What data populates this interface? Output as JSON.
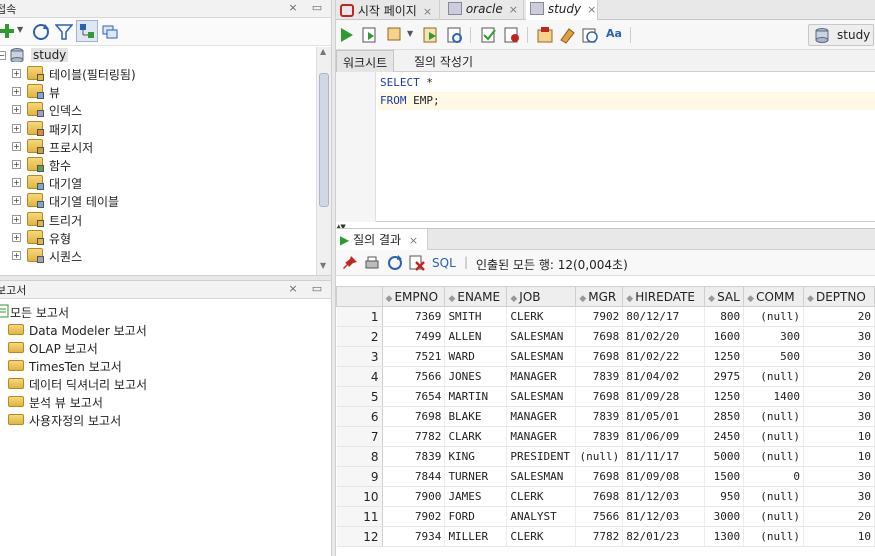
{
  "connections": {
    "title": "접속",
    "tree": {
      "root": "study",
      "items": [
        "테이블(필터링됨)",
        "뷰",
        "인덱스",
        "패키지",
        "프로시저",
        "함수",
        "대기열",
        "대기열 테이블",
        "트리거",
        "유형",
        "시퀀스"
      ]
    }
  },
  "reports": {
    "title": "보고서",
    "root": "모든 보고서",
    "items": [
      "Data Modeler 보고서",
      "OLAP 보고서",
      "TimesTen 보고서",
      "데이터 딕셔너리 보고서",
      "분석 뷰 보고서",
      "사용자정의 보고서"
    ]
  },
  "editor_tabs": [
    {
      "label": "시작 페이지"
    },
    {
      "label": "oracle"
    },
    {
      "label": "study"
    }
  ],
  "toolbar": {
    "connection_label": "study"
  },
  "subtabs": [
    "워크시트",
    "질의 작성기"
  ],
  "sql": {
    "line1_kw": "SELECT",
    "line1_rest": " *",
    "line2_kw": "FROM",
    "line2_rest": " EMP;"
  },
  "results": {
    "tab_label": "질의 결과",
    "sql_label": "SQL",
    "status": "인출된 모든 행: 12(0,004초)",
    "columns": [
      "EMPNO",
      "ENAME",
      "JOB",
      "MGR",
      "HIREDATE",
      "SAL",
      "COMM",
      "DEPTNO"
    ],
    "rows": [
      [
        "1",
        "7369",
        "SMITH",
        "CLERK",
        "7902",
        "80/12/17",
        "800",
        "(null)",
        "20"
      ],
      [
        "2",
        "7499",
        "ALLEN",
        "SALESMAN",
        "7698",
        "81/02/20",
        "1600",
        "300",
        "30"
      ],
      [
        "3",
        "7521",
        "WARD",
        "SALESMAN",
        "7698",
        "81/02/22",
        "1250",
        "500",
        "30"
      ],
      [
        "4",
        "7566",
        "JONES",
        "MANAGER",
        "7839",
        "81/04/02",
        "2975",
        "(null)",
        "20"
      ],
      [
        "5",
        "7654",
        "MARTIN",
        "SALESMAN",
        "7698",
        "81/09/28",
        "1250",
        "1400",
        "30"
      ],
      [
        "6",
        "7698",
        "BLAKE",
        "MANAGER",
        "7839",
        "81/05/01",
        "2850",
        "(null)",
        "30"
      ],
      [
        "7",
        "7782",
        "CLARK",
        "MANAGER",
        "7839",
        "81/06/09",
        "2450",
        "(null)",
        "10"
      ],
      [
        "8",
        "7839",
        "KING",
        "PRESIDENT",
        "(null)",
        "81/11/17",
        "5000",
        "(null)",
        "10"
      ],
      [
        "9",
        "7844",
        "TURNER",
        "SALESMAN",
        "7698",
        "81/09/08",
        "1500",
        "0",
        "30"
      ],
      [
        "10",
        "7900",
        "JAMES",
        "CLERK",
        "7698",
        "81/12/03",
        "950",
        "(null)",
        "30"
      ],
      [
        "11",
        "7902",
        "FORD",
        "ANALYST",
        "7566",
        "81/12/03",
        "3000",
        "(null)",
        "20"
      ],
      [
        "12",
        "7934",
        "MILLER",
        "CLERK",
        "7782",
        "82/01/23",
        "1300",
        "(null)",
        "10"
      ]
    ]
  },
  "colors": {
    "accent": "#2a62b3",
    "run_green": "#2e9b2e",
    "folder": "#e3b43f"
  }
}
